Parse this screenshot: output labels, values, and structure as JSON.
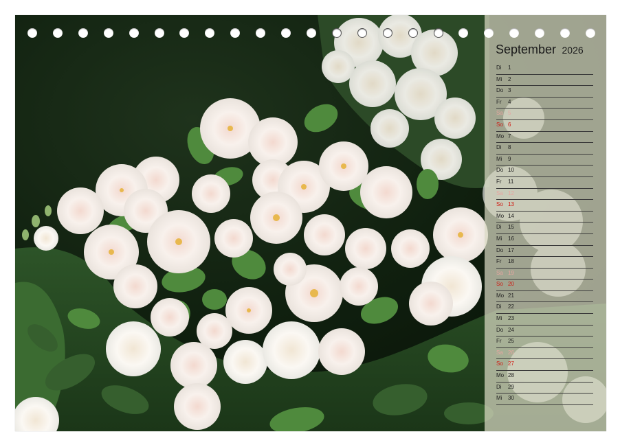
{
  "calendar": {
    "month": "September",
    "year": "2026",
    "days": [
      {
        "dow": "Di",
        "day": "1",
        "type": "weekday"
      },
      {
        "dow": "Mi",
        "day": "2",
        "type": "weekday"
      },
      {
        "dow": "Do",
        "day": "3",
        "type": "weekday"
      },
      {
        "dow": "Fr",
        "day": "4",
        "type": "weekday"
      },
      {
        "dow": "Sa",
        "day": "5",
        "type": "saturday"
      },
      {
        "dow": "So",
        "day": "6",
        "type": "sunday"
      },
      {
        "dow": "Mo",
        "day": "7",
        "type": "weekday"
      },
      {
        "dow": "Di",
        "day": "8",
        "type": "weekday"
      },
      {
        "dow": "Mi",
        "day": "9",
        "type": "weekday"
      },
      {
        "dow": "Do",
        "day": "10",
        "type": "weekday"
      },
      {
        "dow": "Fr",
        "day": "11",
        "type": "weekday"
      },
      {
        "dow": "Sa",
        "day": "12",
        "type": "saturday"
      },
      {
        "dow": "So",
        "day": "13",
        "type": "sunday"
      },
      {
        "dow": "Mo",
        "day": "14",
        "type": "weekday"
      },
      {
        "dow": "Di",
        "day": "15",
        "type": "weekday"
      },
      {
        "dow": "Mi",
        "day": "16",
        "type": "weekday"
      },
      {
        "dow": "Do",
        "day": "17",
        "type": "weekday"
      },
      {
        "dow": "Fr",
        "day": "18",
        "type": "weekday"
      },
      {
        "dow": "Sa",
        "day": "19",
        "type": "saturday"
      },
      {
        "dow": "So",
        "day": "20",
        "type": "sunday"
      },
      {
        "dow": "Mo",
        "day": "21",
        "type": "weekday"
      },
      {
        "dow": "Di",
        "day": "22",
        "type": "weekday"
      },
      {
        "dow": "Mi",
        "day": "23",
        "type": "weekday"
      },
      {
        "dow": "Do",
        "day": "24",
        "type": "weekday"
      },
      {
        "dow": "Fr",
        "day": "25",
        "type": "weekday"
      },
      {
        "dow": "Sa",
        "day": "26",
        "type": "saturday"
      },
      {
        "dow": "So",
        "day": "27",
        "type": "sunday"
      },
      {
        "dow": "Mo",
        "day": "28",
        "type": "weekday"
      },
      {
        "dow": "Di",
        "day": "29",
        "type": "weekday"
      },
      {
        "dow": "Mi",
        "day": "30",
        "type": "weekday"
      }
    ]
  },
  "binding": {
    "hole_count": 23,
    "outlined_holes": [
      12,
      13,
      14,
      15,
      16
    ]
  },
  "colors": {
    "sunday": "#d01810",
    "saturday": "#e6a6a0",
    "text": "#1e1e1e",
    "panel": "#dad9c4",
    "background_dark": "#10200f",
    "leaf": "#3f7a34",
    "rose": "#f6efe8"
  }
}
